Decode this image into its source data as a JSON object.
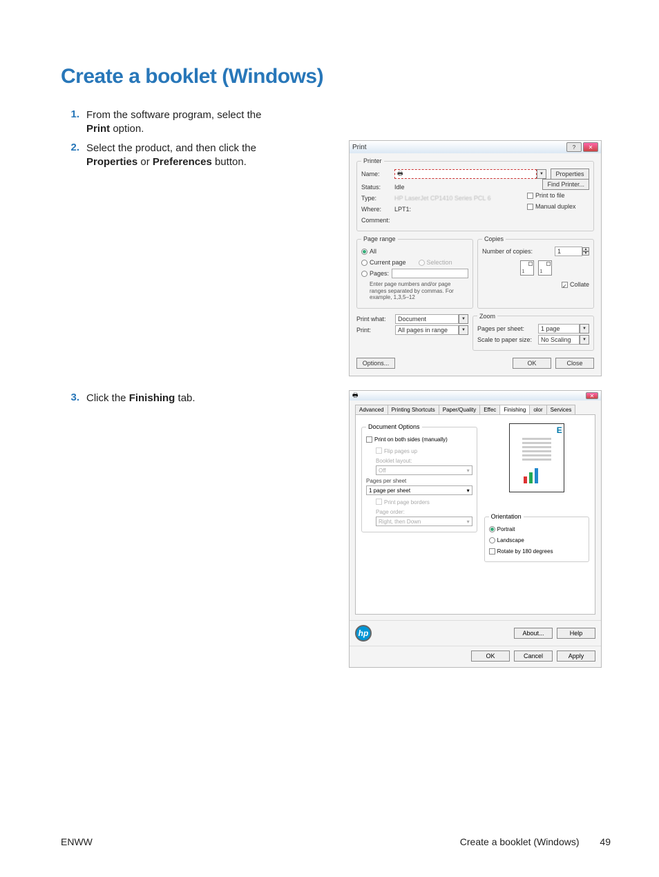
{
  "page": {
    "title": "Create a booklet (Windows)",
    "footer_left": "ENWW",
    "footer_right_text": "Create a booklet (Windows)",
    "footer_page": "49"
  },
  "steps": {
    "s1_num": "1.",
    "s1_a": "From the software program, select the ",
    "s1_b": "Print",
    "s1_c": " option.",
    "s2_num": "2.",
    "s2_a": "Select the product, and then click the ",
    "s2_b": "Properties",
    "s2_c": " or ",
    "s2_d": "Preferences",
    "s2_e": " button.",
    "s3_num": "3.",
    "s3_a": "Click the ",
    "s3_b": "Finishing",
    "s3_c": " tab."
  },
  "print_dialog": {
    "title": "Print",
    "printer_legend": "Printer",
    "name_label": "Name:",
    "name_value": "",
    "properties_btn": "Properties",
    "status_label": "Status:",
    "status_value": "Idle",
    "type_label": "Type:",
    "type_value": "HP LaserJet CP1410 Series PCL 6",
    "where_label": "Where:",
    "where_value": "LPT1:",
    "comment_label": "Comment:",
    "find_printer_btn": "Find Printer...",
    "print_to_file": "Print to file",
    "manual_duplex": "Manual duplex",
    "page_range_legend": "Page range",
    "all_label": "All",
    "current_page_label": "Current page",
    "selection_label": "Selection",
    "pages_label": "Pages:",
    "pages_note": "Enter page numbers and/or page ranges separated by commas. For example, 1,3,5–12",
    "copies_legend": "Copies",
    "num_copies_label": "Number of copies:",
    "num_copies_value": "1",
    "collate_label": "Collate",
    "print_what_label": "Print what:",
    "print_what_value": "Document",
    "print_label": "Print:",
    "print_value": "All pages in range",
    "zoom_legend": "Zoom",
    "pages_per_sheet_label": "Pages per sheet:",
    "pages_per_sheet_value": "1 page",
    "scale_label": "Scale to paper size:",
    "scale_value": "No Scaling",
    "options_btn": "Options...",
    "ok_btn": "OK",
    "close_btn": "Close"
  },
  "prop_dialog": {
    "tabs": [
      "Advanced",
      "Printing Shortcuts",
      "Paper/Quality",
      "Effec",
      "Finishing",
      "olor",
      "Services"
    ],
    "doc_options_legend": "Document Options",
    "print_both_sides": "Print on both sides (manually)",
    "flip_pages_up": "Flip pages up",
    "booklet_layout": "Booklet layout:",
    "booklet_value": "Off",
    "pages_per_sheet_label": "Pages per sheet",
    "pages_per_sheet_value": "1 page per sheet",
    "print_page_borders": "Print page borders",
    "page_order_label": "Page order:",
    "page_order_value": "Right, then Down",
    "orientation_legend": "Orientation",
    "portrait_label": "Portrait",
    "landscape_label": "Landscape",
    "rotate_label": "Rotate by 180 degrees",
    "preview_letter": "E",
    "hp_logo": "hp",
    "about_btn": "About...",
    "help_btn": "Help",
    "ok_btn": "OK",
    "cancel_btn": "Cancel",
    "apply_btn": "Apply"
  }
}
